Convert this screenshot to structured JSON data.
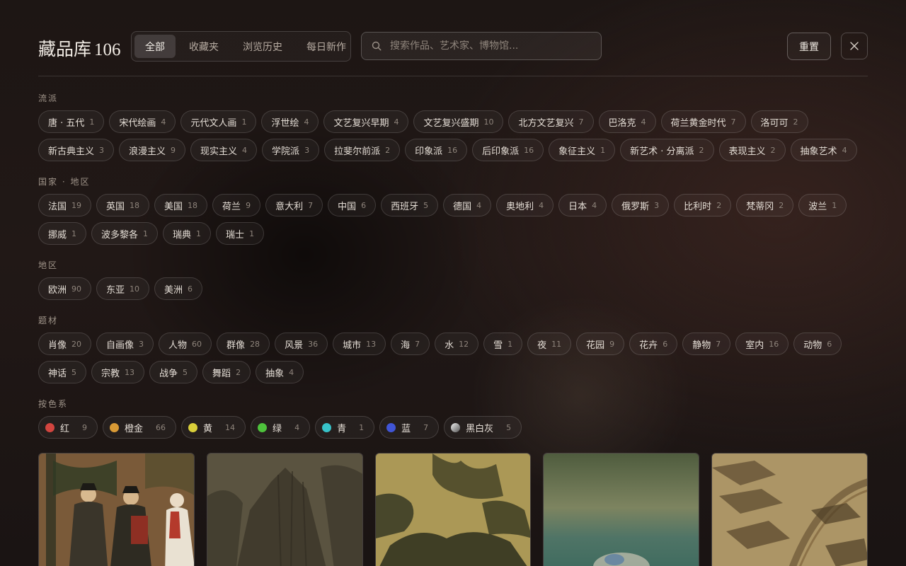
{
  "header": {
    "title": "藏品库",
    "count": "106",
    "tabs": [
      "全部",
      "收藏夹",
      "浏览历史",
      "每日新作"
    ],
    "active_tab": 0,
    "search_placeholder": "搜索作品、艺术家、博物馆...",
    "reset_label": "重置"
  },
  "sections": {
    "school": {
      "label": "流派",
      "chips": [
        {
          "label": "唐 · 五代",
          "count": "1"
        },
        {
          "label": "宋代绘画",
          "count": "4"
        },
        {
          "label": "元代文人画",
          "count": "1"
        },
        {
          "label": "浮世绘",
          "count": "4"
        },
        {
          "label": "文艺复兴早期",
          "count": "4"
        },
        {
          "label": "文艺复兴盛期",
          "count": "10"
        },
        {
          "label": "北方文艺复兴",
          "count": "7"
        },
        {
          "label": "巴洛克",
          "count": "4"
        },
        {
          "label": "荷兰黄金时代",
          "count": "7"
        },
        {
          "label": "洛可可",
          "count": "2"
        },
        {
          "label": "新古典主义",
          "count": "3"
        },
        {
          "label": "浪漫主义",
          "count": "9"
        },
        {
          "label": "现实主义",
          "count": "4"
        },
        {
          "label": "学院派",
          "count": "3"
        },
        {
          "label": "拉斐尔前派",
          "count": "2"
        },
        {
          "label": "印象派",
          "count": "16"
        },
        {
          "label": "后印象派",
          "count": "16"
        },
        {
          "label": "象征主义",
          "count": "1"
        },
        {
          "label": "新艺术 · 分离派",
          "count": "2"
        },
        {
          "label": "表现主义",
          "count": "2"
        },
        {
          "label": "抽象艺术",
          "count": "4"
        }
      ]
    },
    "country": {
      "label": "国家 · 地区",
      "chips": [
        {
          "label": "法国",
          "count": "19"
        },
        {
          "label": "英国",
          "count": "18"
        },
        {
          "label": "美国",
          "count": "18"
        },
        {
          "label": "荷兰",
          "count": "9"
        },
        {
          "label": "意大利",
          "count": "7"
        },
        {
          "label": "中国",
          "count": "6"
        },
        {
          "label": "西班牙",
          "count": "5"
        },
        {
          "label": "德国",
          "count": "4"
        },
        {
          "label": "奥地利",
          "count": "4"
        },
        {
          "label": "日本",
          "count": "4"
        },
        {
          "label": "俄罗斯",
          "count": "3"
        },
        {
          "label": "比利时",
          "count": "2"
        },
        {
          "label": "梵蒂冈",
          "count": "2"
        },
        {
          "label": "波兰",
          "count": "1"
        },
        {
          "label": "挪威",
          "count": "1"
        },
        {
          "label": "波多黎各",
          "count": "1"
        },
        {
          "label": "瑞典",
          "count": "1"
        },
        {
          "label": "瑞士",
          "count": "1"
        }
      ]
    },
    "region": {
      "label": "地区",
      "chips": [
        {
          "label": "欧洲",
          "count": "90"
        },
        {
          "label": "东亚",
          "count": "10"
        },
        {
          "label": "美洲",
          "count": "6"
        }
      ]
    },
    "subject": {
      "label": "题材",
      "chips": [
        {
          "label": "肖像",
          "count": "20"
        },
        {
          "label": "自画像",
          "count": "3"
        },
        {
          "label": "人物",
          "count": "60"
        },
        {
          "label": "群像",
          "count": "28"
        },
        {
          "label": "风景",
          "count": "36"
        },
        {
          "label": "城市",
          "count": "13"
        },
        {
          "label": "海",
          "count": "7"
        },
        {
          "label": "水",
          "count": "12"
        },
        {
          "label": "雪",
          "count": "1"
        },
        {
          "label": "夜",
          "count": "11"
        },
        {
          "label": "花园",
          "count": "9"
        },
        {
          "label": "花卉",
          "count": "6"
        },
        {
          "label": "静物",
          "count": "7"
        },
        {
          "label": "室内",
          "count": "16"
        },
        {
          "label": "动物",
          "count": "6"
        },
        {
          "label": "神话",
          "count": "5"
        },
        {
          "label": "宗教",
          "count": "13"
        },
        {
          "label": "战争",
          "count": "5"
        },
        {
          "label": "舞蹈",
          "count": "2"
        },
        {
          "label": "抽象",
          "count": "4"
        }
      ]
    },
    "color": {
      "label": "按色系",
      "chips": [
        {
          "label": "红",
          "count": "9",
          "color": "#d2453f"
        },
        {
          "label": "橙金",
          "count": "66",
          "color": "#d99a35"
        },
        {
          "label": "黄",
          "count": "14",
          "color": "#d9cf3a"
        },
        {
          "label": "绿",
          "count": "4",
          "color": "#4ec23c"
        },
        {
          "label": "青",
          "count": "1",
          "color": "#37c2c8"
        },
        {
          "label": "蓝",
          "count": "7",
          "color": "#4055d6"
        },
        {
          "label": "黑白灰",
          "count": "5",
          "color": "gradient-gray"
        }
      ]
    }
  },
  "gallery": {
    "items": [
      {
        "icon": "painting-figures-thumbnail"
      },
      {
        "icon": "painting-mountain-thumbnail"
      },
      {
        "icon": "painting-landscape-thumbnail"
      },
      {
        "icon": "painting-blurred-thumbnail"
      },
      {
        "icon": "painting-cityscape-thumbnail"
      }
    ]
  }
}
